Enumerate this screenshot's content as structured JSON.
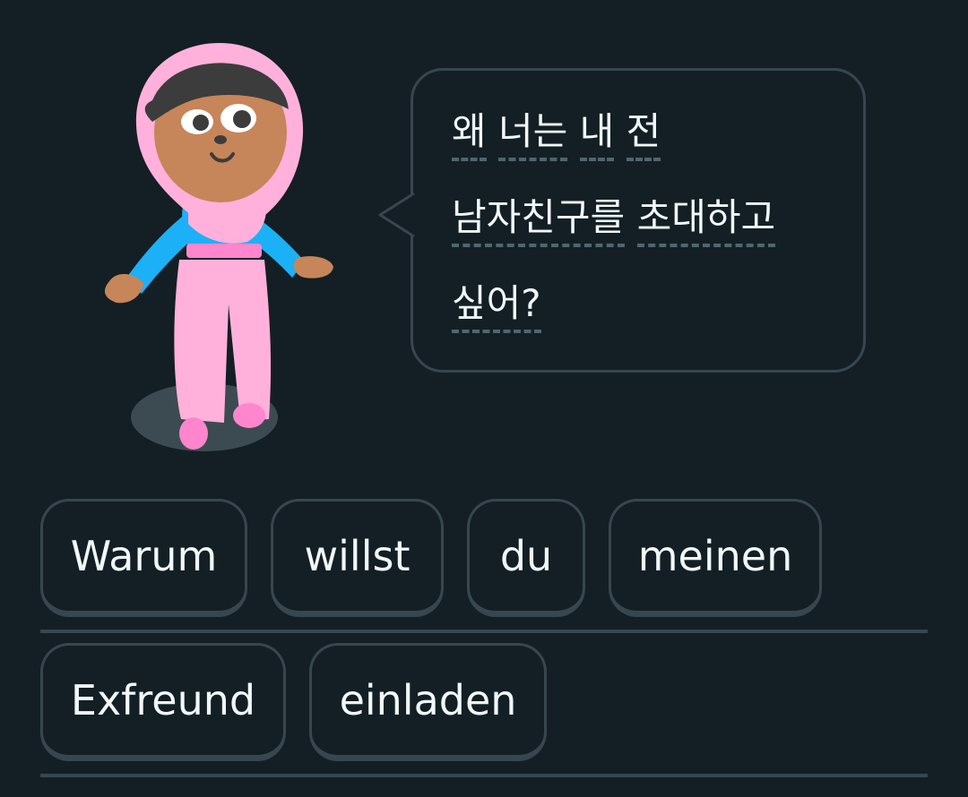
{
  "prompt": {
    "lines": [
      [
        "왜",
        "너는",
        "내",
        "전"
      ],
      [
        "남자친구를",
        "초대하고"
      ],
      [
        "싶어?"
      ]
    ]
  },
  "word_bank": {
    "row1": [
      "Warum",
      "willst",
      "du",
      "meinen"
    ],
    "row2": [
      "Exfreund",
      "einladen"
    ]
  },
  "colors": {
    "background": "#131f24",
    "border": "#37464f",
    "text": "#f1f7fb",
    "dash": "#52656d",
    "skin": "#c7855a",
    "hijab": "#ffb1dc",
    "shirt": "#1cb0f6",
    "pants": "#ffb1dc"
  },
  "icons": {
    "character": "lin-character-illustration"
  }
}
